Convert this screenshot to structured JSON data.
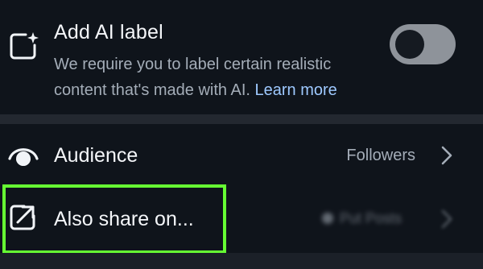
{
  "ai_label": {
    "title": "Add AI label",
    "description": "We require you to label certain realistic content that's made with AI.",
    "learn_more": "Learn more",
    "toggle_state": "off"
  },
  "audience": {
    "label": "Audience",
    "value": "Followers"
  },
  "share": {
    "label": "Also share on...",
    "value_obscured": "Put Posts"
  },
  "colors": {
    "background": "#0f141b",
    "link": "#9ec9ff",
    "highlight": "#66ff33",
    "toggle_track": "#8e939a"
  },
  "icons": {
    "ai_label": "sparkle-square-icon",
    "audience": "eye-icon",
    "share": "share-arrow-icon",
    "chevron": "chevron-right-icon"
  }
}
